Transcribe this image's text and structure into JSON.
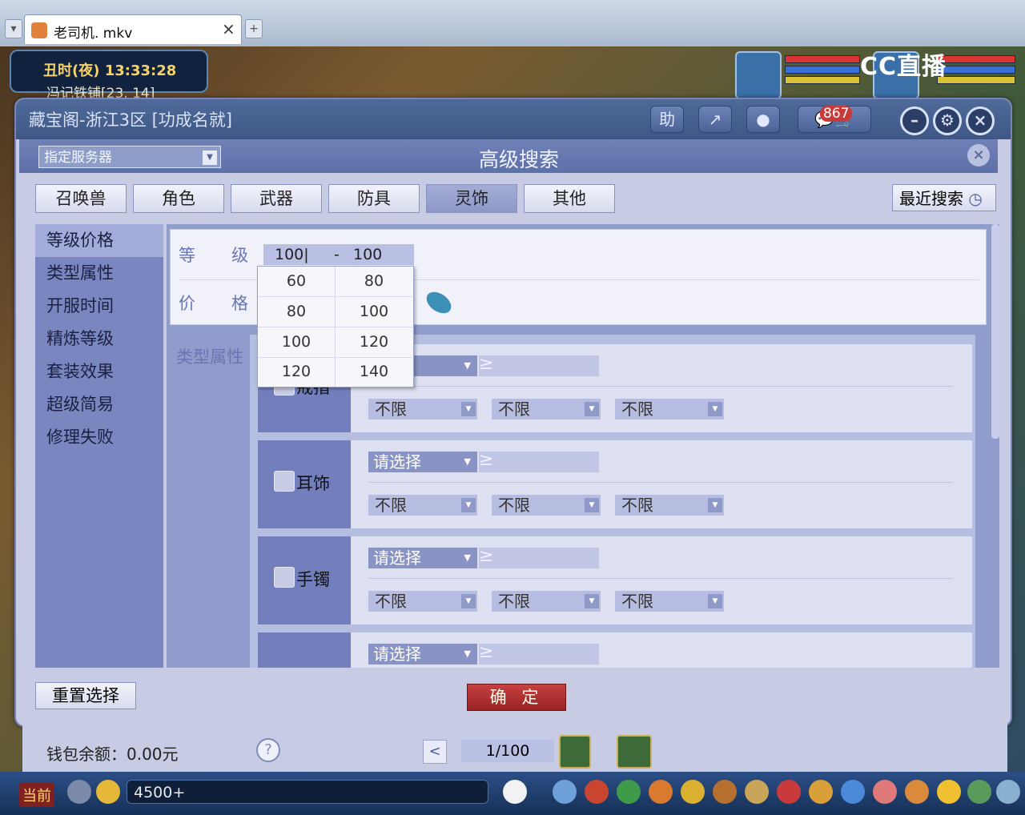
{
  "player": {
    "tab_title": "老司机. mkv",
    "tab_close": "×",
    "new_tab": "+"
  },
  "game": {
    "clock": "丑时(夜)  13:33:28",
    "location": "冯记铁铺[23, 14]",
    "watermark": "CC直播",
    "chat_input": "4500+",
    "now_label": "当前"
  },
  "window": {
    "title": "藏宝阁-浙江3区 [功成名就]",
    "toolbar": {
      "help": "助",
      "share_icon": "share-icon",
      "record_icon": "record-icon",
      "messages_count": "867"
    },
    "header": {
      "server_select": "指定服务器",
      "title": "高级搜索",
      "close": "×"
    },
    "categories": [
      {
        "label": "召唤兽",
        "active": false
      },
      {
        "label": "角色",
        "active": false
      },
      {
        "label": "武器",
        "active": false
      },
      {
        "label": "防具",
        "active": false
      },
      {
        "label": "灵饰",
        "active": true
      },
      {
        "label": "其他",
        "active": false
      }
    ],
    "recent_search": "最近搜索",
    "sidebar": [
      {
        "label": "等级价格",
        "active": true
      },
      {
        "label": "类型属性",
        "active": false
      },
      {
        "label": "开服时间",
        "active": false
      },
      {
        "label": "精炼等级",
        "active": false
      },
      {
        "label": "套装效果",
        "active": false
      },
      {
        "label": "超级简易",
        "active": false
      },
      {
        "label": "修理失败",
        "active": false
      }
    ],
    "level": {
      "label_1": "等",
      "label_2": "级",
      "min": "100|",
      "dash": "-",
      "max": "100"
    },
    "price": {
      "label_1": "价",
      "label_2": "格"
    },
    "level_dropdown": [
      [
        "60",
        "80"
      ],
      [
        "80",
        "100"
      ],
      [
        "100",
        "120"
      ],
      [
        "120",
        "140"
      ]
    ],
    "type_label": "类型属性",
    "groups": [
      {
        "name": "戒指",
        "select": "择",
        "ge": "≥",
        "options": [
          "不限",
          "不限",
          "不限"
        ]
      },
      {
        "name": "耳饰",
        "select": "请选择",
        "ge": "≥",
        "options": [
          "不限",
          "不限",
          "不限"
        ]
      },
      {
        "name": "手镯",
        "select": "请选择",
        "ge": "≥",
        "options": [
          "不限",
          "不限",
          "不限"
        ]
      },
      {
        "name": "",
        "select": "请选择",
        "ge": "≥",
        "options": []
      }
    ],
    "reset_button": "重置选择",
    "confirm_button": "确 定",
    "wallet": "钱包余额：0.00元",
    "help": "?",
    "prev_page": "<",
    "page": "1/100"
  }
}
